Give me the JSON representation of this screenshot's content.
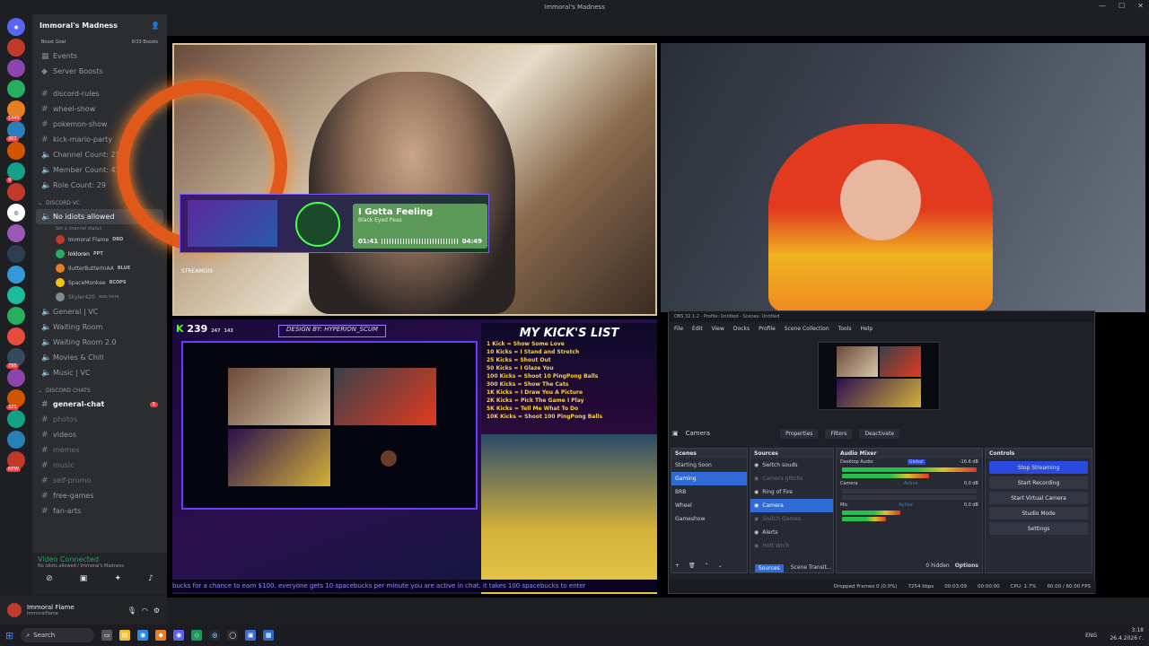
{
  "window": {
    "title": "Immoral's Madness"
  },
  "server": {
    "name": "Immoral's Madness",
    "boost_goal": "Boost Goal",
    "boost_count": "0/33 Boosts"
  },
  "nav": [
    {
      "label": "Events"
    },
    {
      "label": "Server Boosts"
    }
  ],
  "channels": [
    {
      "label": "discord-rules"
    },
    {
      "label": "wheel-show"
    },
    {
      "label": "pokemon-show"
    },
    {
      "label": "kick-mario-party"
    },
    {
      "label": "Channel Count: 21"
    },
    {
      "label": "Member Count: 414"
    },
    {
      "label": "Role Count: 29"
    }
  ],
  "voice_category": "DISCORD VC",
  "active_voice": {
    "label": "No idiots allowed",
    "sub": "Set a channel status"
  },
  "voice_users": [
    {
      "name": "Immoral Flame",
      "tag": "DBD"
    },
    {
      "name": "lokloren",
      "tag": "PPT"
    },
    {
      "name": "IlutterButterInAA",
      "tag": "BLUE"
    },
    {
      "name": "SpaceMonkee",
      "tag": "BCOPS"
    },
    {
      "name": "Skyler420",
      "tag": "was here"
    }
  ],
  "voice_channels": [
    {
      "label": "General | VC"
    },
    {
      "label": "Waiting Room"
    },
    {
      "label": "Waiting Room 2.0"
    },
    {
      "label": "Movies & Chill"
    },
    {
      "label": "Music | VC"
    }
  ],
  "chat_category": "DISCORD CHATS",
  "text_channels": [
    {
      "label": "general-chat",
      "badge": "1"
    },
    {
      "label": "photos"
    },
    {
      "label": "videos"
    },
    {
      "label": "memes"
    },
    {
      "label": "music"
    },
    {
      "label": "self-promo"
    },
    {
      "label": "free-games"
    },
    {
      "label": "fan-arts"
    }
  ],
  "voice_status": {
    "title": "Video Connected",
    "sub": "No idiots allowed / Immoral's Madness"
  },
  "user": {
    "name": "Immoral Flame",
    "sub": "immoralflame"
  },
  "server_badges": [
    "1449",
    "302",
    "9",
    "795",
    "321",
    "NEW"
  ],
  "stream": {
    "kick_count": "239",
    "viewers_a": "247",
    "viewers_b": "143",
    "design_credit": "DESIGN BY: HYPERION_SCUM",
    "list_title": "MY KICK'S LIST",
    "list_items": [
      "1 Kick = Show Some Love",
      "10 Kicks = I Stand and Stretch",
      "25 Kicks = Shout Out",
      "50 Kicks = I Glaze You",
      "100 Kicks = Shoot 10 PingPong Balls",
      "300 Kicks = Show The Cats",
      "1K Kicks = I Draw You A Picture",
      "2K Kicks = Pick The Game I Play",
      "5K Kicks = Tell Me What To Do",
      "10K Kicks = Shoot 100 PingPong Balls"
    ],
    "song_title": "I Gotta Feeling",
    "song_artist": "Black Eyed Peas",
    "time_elapsed": "01:41",
    "time_total": "04:49",
    "ticker": "bucks for a chance to earn $100. everyone gets 10 spacebucks per minute you are active in chat. it takes 100 spacebucks to enter",
    "cam_label": "STREAMDIS"
  },
  "obs": {
    "title": "OBS 32.1.2 - Profile: Untitled - Scenes: Untitled",
    "menu": [
      "File",
      "Edit",
      "View",
      "Docks",
      "Profile",
      "Scene Collection",
      "Tools",
      "Help"
    ],
    "source_label": "Camera",
    "properties": "Properties",
    "filters": "Filters",
    "deactivate": "Deactivate",
    "scenes_header": "Scenes",
    "scenes": [
      "Starting Soon",
      "Gaming",
      "BRB",
      "Wheel",
      "Gameshow"
    ],
    "scene_selected": 1,
    "sources_header": "Sources",
    "sources": [
      "Switch souds",
      "Camera glitchs",
      "Ring of Fire",
      "Camera",
      "Switch Games",
      "Alerts",
      "Hott Wrch"
    ],
    "source_selected": 3,
    "mixer_header": "Audio Mixer",
    "mixer": [
      {
        "name": "Desktop Audio",
        "tag": "Global",
        "db": "-16.6 dB"
      },
      {
        "name": "Camera",
        "tag": "Active",
        "db": "0.0 dB"
      },
      {
        "name": "Mic",
        "tag": "Active",
        "db": "0.0 dB"
      }
    ],
    "controls_header": "Controls",
    "controls": [
      "Stop Streaming",
      "Start Recording",
      "Start Virtual Camera",
      "Studio Mode",
      "Settings"
    ],
    "tabs": [
      "Sources",
      "Scene Transit..."
    ],
    "hidden": "0 hidden",
    "options": "Options",
    "status": {
      "dropped": "Dropped Frames 0 (0.0%)",
      "kbps": "7254 kbps",
      "rec_time": "00:03:09",
      "time2": "00:00:00",
      "cpu": "CPU: 1.7%",
      "fps": "60.00 / 60.00 FPS"
    }
  },
  "taskbar": {
    "search": "Search",
    "lang": "ENG",
    "time": "3:18",
    "date": "26.4.2026 г."
  }
}
